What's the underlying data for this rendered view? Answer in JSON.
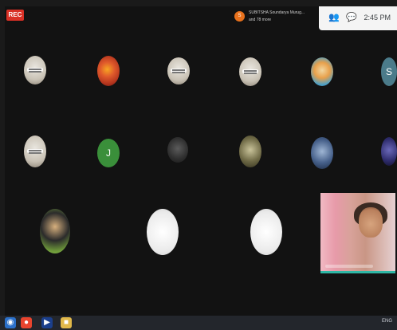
{
  "recording": {
    "label": "REC"
  },
  "presenter": {
    "initial": "S",
    "line1": "SUBITSHA Soundarya Murug...",
    "line2": "and 78 more"
  },
  "top_controls": {
    "participants_icon": "people-icon",
    "chat_icon": "chat-icon",
    "time": "2:45 PM"
  },
  "tiles": [
    {
      "name": "participant-tile",
      "variant": "thumb-light",
      "letter": ""
    },
    {
      "name": "participant-tile",
      "variant": "thumb-flower",
      "letter": ""
    },
    {
      "name": "participant-tile",
      "variant": "thumb-light",
      "letter": ""
    },
    {
      "name": "participant-tile",
      "variant": "thumb-light",
      "letter": ""
    },
    {
      "name": "participant-tile",
      "variant": "thumb-cartoon",
      "letter": ""
    },
    {
      "name": "participant-tile",
      "variant": "letter",
      "letter": "S",
      "color": "#4b7b8a"
    },
    {
      "name": "participant-tile",
      "variant": "thumb-light",
      "letter": ""
    },
    {
      "name": "participant-tile",
      "variant": "letter",
      "letter": "J",
      "color": "#3a8f3a"
    },
    {
      "name": "participant-tile",
      "variant": "thumb-dark",
      "letter": ""
    },
    {
      "name": "participant-tile",
      "variant": "thumb-olive",
      "letter": ""
    },
    {
      "name": "participant-tile",
      "variant": "thumb-blue",
      "letter": ""
    },
    {
      "name": "participant-tile",
      "variant": "thumb-purple",
      "letter": ""
    },
    {
      "name": "participant-tile",
      "variant": "thumb-girl",
      "letter": ""
    },
    {
      "name": "participant-tile",
      "variant": "thumb-white",
      "letter": ""
    },
    {
      "name": "participant-tile",
      "variant": "thumb-white",
      "letter": ""
    }
  ],
  "self_view": {
    "name": "self-video"
  },
  "taskbar": {
    "items": [
      "start-icon",
      "chrome-icon",
      "media-icon",
      "files-icon"
    ],
    "clock": "ENG"
  },
  "colors": {
    "background": "#121212",
    "rec": "#d93025",
    "accent": "#2fb7a5"
  }
}
